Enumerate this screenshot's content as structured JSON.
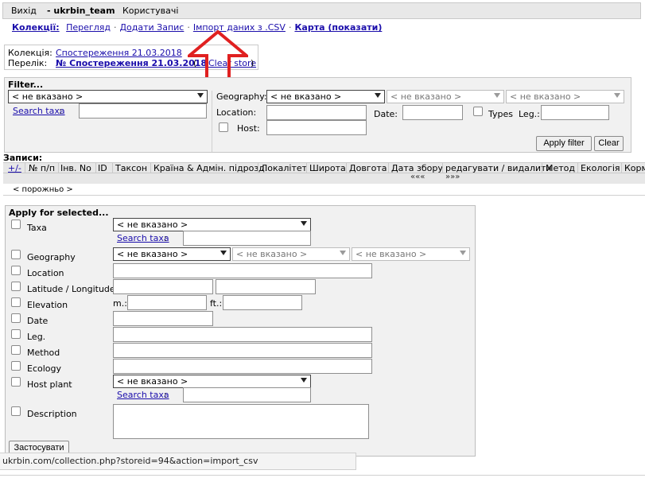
{
  "topbar": {
    "exit": "Вихід",
    "user": "- ukrbin_team",
    "users": "Користувачі"
  },
  "nav": {
    "collections": "Колекції:",
    "view": "Перегляд",
    "add_record": "Додати Запис",
    "import_csv": "Імпорт даних з .CSV",
    "map": "Карта (показати)"
  },
  "info": {
    "collection_label": "Колекція:",
    "collection_value": "Спостереження 21.03.2018",
    "list_label": "Перелік:",
    "list_value": "№   Спостереження 21.03.2018",
    "clear_paren_open": "(",
    "clear_store": "Clear store",
    "clear_paren_close": ")"
  },
  "filter": {
    "title": "Filter...",
    "taxa_select": "< не вказано >",
    "search_taxa": "Search taxa",
    "search_colon": ":",
    "geography_label": "Geography:",
    "geo1": "< не вказано >",
    "geo2": "< не вказано >",
    "geo3": "< не вказано >",
    "location_label": "Location:",
    "date_label": "Date:",
    "types_label": "Types",
    "leg_label": "Leg.:",
    "host_label": "Host:",
    "apply_filter": "Apply filter",
    "clear": "Clear"
  },
  "records": {
    "title": "Записи:",
    "columns": [
      "+/-",
      "№ п/п",
      "Інв. No",
      "ID",
      "Таксон",
      "Країна & Адмін. підрозд.",
      "Локалітет",
      "Широта",
      "Довгота",
      "Дата збору",
      "редагувати / видалити",
      "Метод",
      "Екологія",
      "Корм"
    ],
    "prev_page": "«««",
    "next_page": "»»»",
    "empty": "< порожньо >"
  },
  "apply": {
    "title": "Apply for selected...",
    "taxa_label": "Taxa",
    "taxa_select": "< не вказано >",
    "search_taxa": "Search taxa",
    "colon": ":",
    "geography_label": "Geography",
    "geo1": "< не вказано >",
    "geo2": "< не вказано >",
    "geo3": "< не вказано >",
    "location_label": "Location",
    "latlon_label": "Latitude / Longitude",
    "elevation_label": "Elevation",
    "m_label": "m.:",
    "ft_label": "ft.:",
    "date_label": "Date",
    "leg_label": "Leg.",
    "method_label": "Method",
    "ecology_label": "Ecology",
    "host_label": "Host plant",
    "host_select": "< не вказано >",
    "search_taxa2": "Search taxa",
    "description_label": "Description",
    "submit": "Застосувати"
  },
  "status": {
    "url": "ukrbin.com/collection.php?storeid=94&action=import_csv"
  },
  "colors": {
    "accent_link": "#1a0dab",
    "arrow_red": "#e02020"
  }
}
